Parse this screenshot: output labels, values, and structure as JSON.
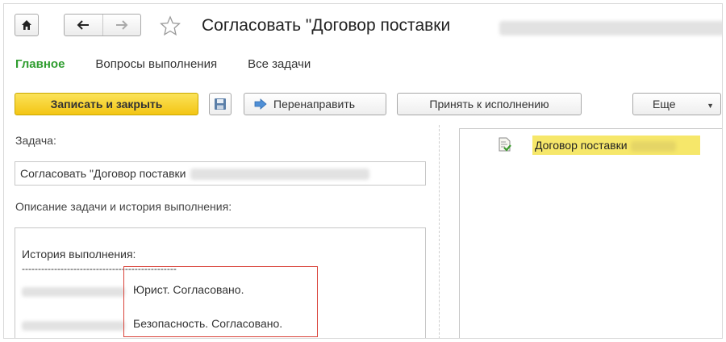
{
  "window": {
    "title": "Согласовать \"Договор поставки"
  },
  "tabs": [
    {
      "label": "Главное",
      "active": true
    },
    {
      "label": "Вопросы выполнения",
      "active": false
    },
    {
      "label": "Все задачи",
      "active": false
    }
  ],
  "toolbar": {
    "save_close_label": "Записать и закрыть",
    "redirect_label": "Перенаправить",
    "accept_label": "Принять к исполнению",
    "more_label": "Еще"
  },
  "task": {
    "label": "Задача:",
    "value": "Согласовать \"Договор поставки"
  },
  "description": {
    "label": "Описание задачи и история выполнения:",
    "history_title": "История выполнения:",
    "separator": "------------------------------------------------",
    "entries": [
      {
        "text": "Юрист. Согласовано."
      },
      {
        "text": "Безопасность. Согласовано."
      }
    ]
  },
  "attachments": [
    {
      "label": "Договор поставки",
      "icon": "document-check-icon",
      "selected": true
    }
  ],
  "colors": {
    "accent_green": "#2f9d2f",
    "primary_button": "#f3c514",
    "highlight": "#f6e76a",
    "annotation_red": "#d9433a"
  }
}
